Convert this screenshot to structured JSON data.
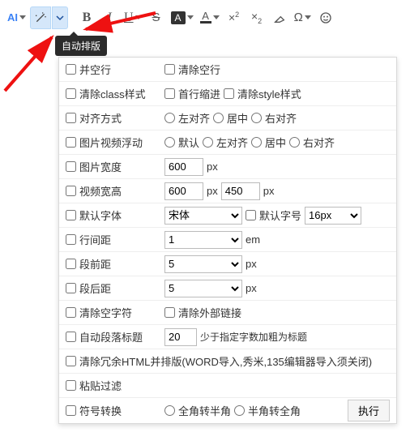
{
  "tooltip": "自动排版",
  "toolbar": {
    "ai_label": "AI"
  },
  "rows": {
    "merge_blank": "并空行",
    "clear_blank": "清除空行",
    "clear_class": "清除class样式",
    "first_indent": "首行缩进",
    "clear_style": "清除style样式",
    "align": "对齐方式",
    "align_left": "左对齐",
    "align_center": "居中",
    "align_right": "右对齐",
    "media_float": "图片视频浮动",
    "float_default": "默认",
    "float_left": "左对齐",
    "float_center": "居中",
    "float_right": "右对齐",
    "img_width": "图片宽度",
    "img_width_val": "600",
    "px": "px",
    "video_wh": "视频宽高",
    "video_w_val": "600",
    "video_h_val": "450",
    "def_font": "默认字体",
    "font_option": "宋体",
    "def_size": "默认字号",
    "size_option": "16px",
    "line_height": "行间距",
    "lh_option": "1",
    "em": "em",
    "para_before": "段前距",
    "pb_option": "5",
    "para_after": "段后距",
    "pa_option": "5",
    "clear_empty_char": "清除空字符",
    "clear_ext_link": "清除外部链接",
    "auto_para_title": "自动段落标题",
    "auto_para_val": "20",
    "auto_para_hint": "少于指定字数加粗为标题",
    "clear_redundant": "清除冗余HTML并排版(WORD导入,秀米,135编辑器导入须关闭)",
    "paste_filter": "粘贴过滤",
    "char_convert": "符号转换",
    "full_to_half": "全角转半角",
    "half_to_full": "半角转全角",
    "execute": "执行"
  }
}
